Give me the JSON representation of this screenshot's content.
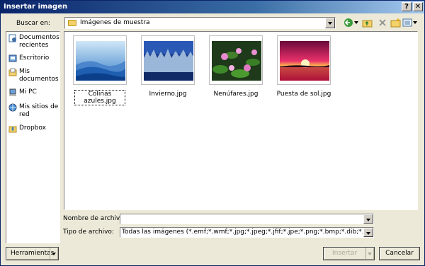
{
  "window": {
    "title": "Insertar imagen"
  },
  "lookin": {
    "label": "Buscar en:",
    "value": "Imágenes de muestra"
  },
  "places": [
    {
      "label": "Documentos recientes",
      "icon": "recent-documents-icon"
    },
    {
      "label": "Escritorio",
      "icon": "desktop-icon"
    },
    {
      "label": "Mis documentos",
      "icon": "my-documents-icon"
    },
    {
      "label": "Mi PC",
      "icon": "my-computer-icon"
    },
    {
      "label": "Mis sitios de red",
      "icon": "network-places-icon"
    },
    {
      "label": "Dropbox",
      "icon": "dropbox-icon"
    }
  ],
  "files": [
    {
      "name": "Colinas azules.jpg",
      "selected": true
    },
    {
      "name": "Invierno.jpg",
      "selected": false
    },
    {
      "name": "Nenúfares.jpg",
      "selected": false
    },
    {
      "name": "Puesta de sol.jpg",
      "selected": false
    }
  ],
  "filename": {
    "label": "Nombre de archivo:",
    "value": ""
  },
  "filetype": {
    "label": "Tipo de archivo:",
    "value": "Todas las imágenes (*.emf;*.wmf;*.jpg;*.jpeg;*.jfif;*.jpe;*.png;*.bmp;*.dib;*.rle;*.bmz;*.gif;*.gfa;*.emz;*.wmz;*.pcz;*.tif;*.tiff;*.cdr;*.cgm;*.eps;*.pct;*.pict;*.wpg)"
  },
  "buttons": {
    "tools": "Herramientas",
    "insert": "Insertar",
    "cancel": "Cancelar"
  },
  "titlebar_buttons": {
    "help": "?",
    "close": "✕"
  },
  "colors": {
    "titlebar": "#0a246a",
    "face": "#ece9d8",
    "folder": "#f3d269"
  }
}
